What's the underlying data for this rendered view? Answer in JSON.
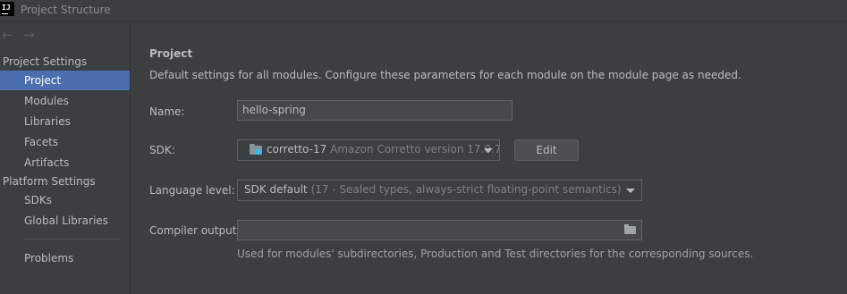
{
  "window": {
    "app_icon_text": "IJ",
    "title": "Project Structure"
  },
  "nav": {
    "back_icon": "arrow-left-icon",
    "forward_icon": "arrow-right-icon",
    "back_glyph": "←",
    "forward_glyph": "→"
  },
  "sidebar": {
    "project_settings_title": "Project Settings",
    "project_items": [
      "Project",
      "Modules",
      "Libraries",
      "Facets",
      "Artifacts"
    ],
    "platform_settings_title": "Platform Settings",
    "platform_items": [
      "SDKs",
      "Global Libraries"
    ],
    "problems_label": "Problems",
    "selected_item": "Project"
  },
  "main": {
    "heading": "Project",
    "description": "Default settings for all modules. Configure these parameters for each module on the module page as needed.",
    "name_label": "Name:",
    "name_value": "hello-spring",
    "sdk_label": "SDK:",
    "sdk_name": "corretto-17",
    "sdk_detail": "Amazon Corretto version 17.0.7",
    "edit_button": "Edit",
    "language_level_label": "Language level:",
    "language_level_value": "SDK default",
    "language_level_detail": "(17 - Sealed types, always-strict floating-point semantics)",
    "compiler_output_label": "Compiler output:",
    "compiler_output_value": "",
    "compiler_output_note": "Used for modules' subdirectories, Production and Test directories for the corresponding sources."
  },
  "colors": {
    "selection": "#4b6eaf",
    "panel_bg": "#3c3f41",
    "text": "#bbbbbb",
    "muted_text": "#808080"
  }
}
